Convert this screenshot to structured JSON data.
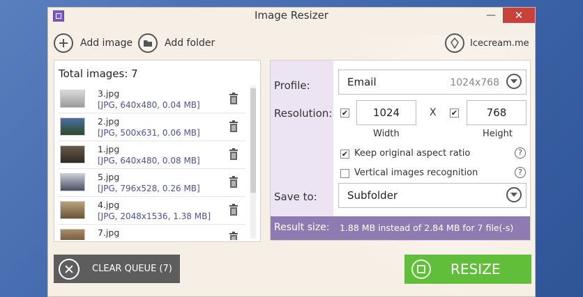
{
  "window": {
    "title": "Image Resizer",
    "minimize_label": "—",
    "close_label": "✕"
  },
  "toolbar": {
    "add_image": "Add image",
    "add_folder": "Add folder",
    "brand": "Icecream.me"
  },
  "queue": {
    "total_label": "Total images: 7",
    "items": [
      {
        "name": "3.jpg",
        "info": "[JPG, 640x480, 0.04 MB]"
      },
      {
        "name": "2.jpg",
        "info": "[JPG, 500x631, 0.06 MB]"
      },
      {
        "name": "1.jpg",
        "info": "[JPG, 640x480, 0.08 MB]"
      },
      {
        "name": "5.jpg",
        "info": "[JPG, 796x528, 0.26 MB]"
      },
      {
        "name": "4.jpg",
        "info": "[JPG, 2048x1536, 1.38 MB]"
      },
      {
        "name": "7.jpg",
        "info": ""
      }
    ]
  },
  "settings": {
    "profile_label": "Profile:",
    "profile_value": "Email",
    "profile_dims": "1024x768",
    "resolution_label": "Resolution:",
    "width_value": "1024",
    "height_value": "768",
    "x_separator": "X",
    "width_label": "Width",
    "height_label": "Height",
    "keep_ratio_label": "Keep original aspect ratio",
    "vertical_label": "Vertical images recognition",
    "save_to_label": "Save to:",
    "save_to_value": "Subfolder",
    "help_glyph": "?",
    "check_glyph": "✔"
  },
  "result": {
    "label": "Result size:",
    "value": "1.88 MB instead of 2.84 MB for 7 file(-s)"
  },
  "actions": {
    "clear_queue": "CLEAR QUEUE (7)",
    "resize": "RESIZE"
  }
}
